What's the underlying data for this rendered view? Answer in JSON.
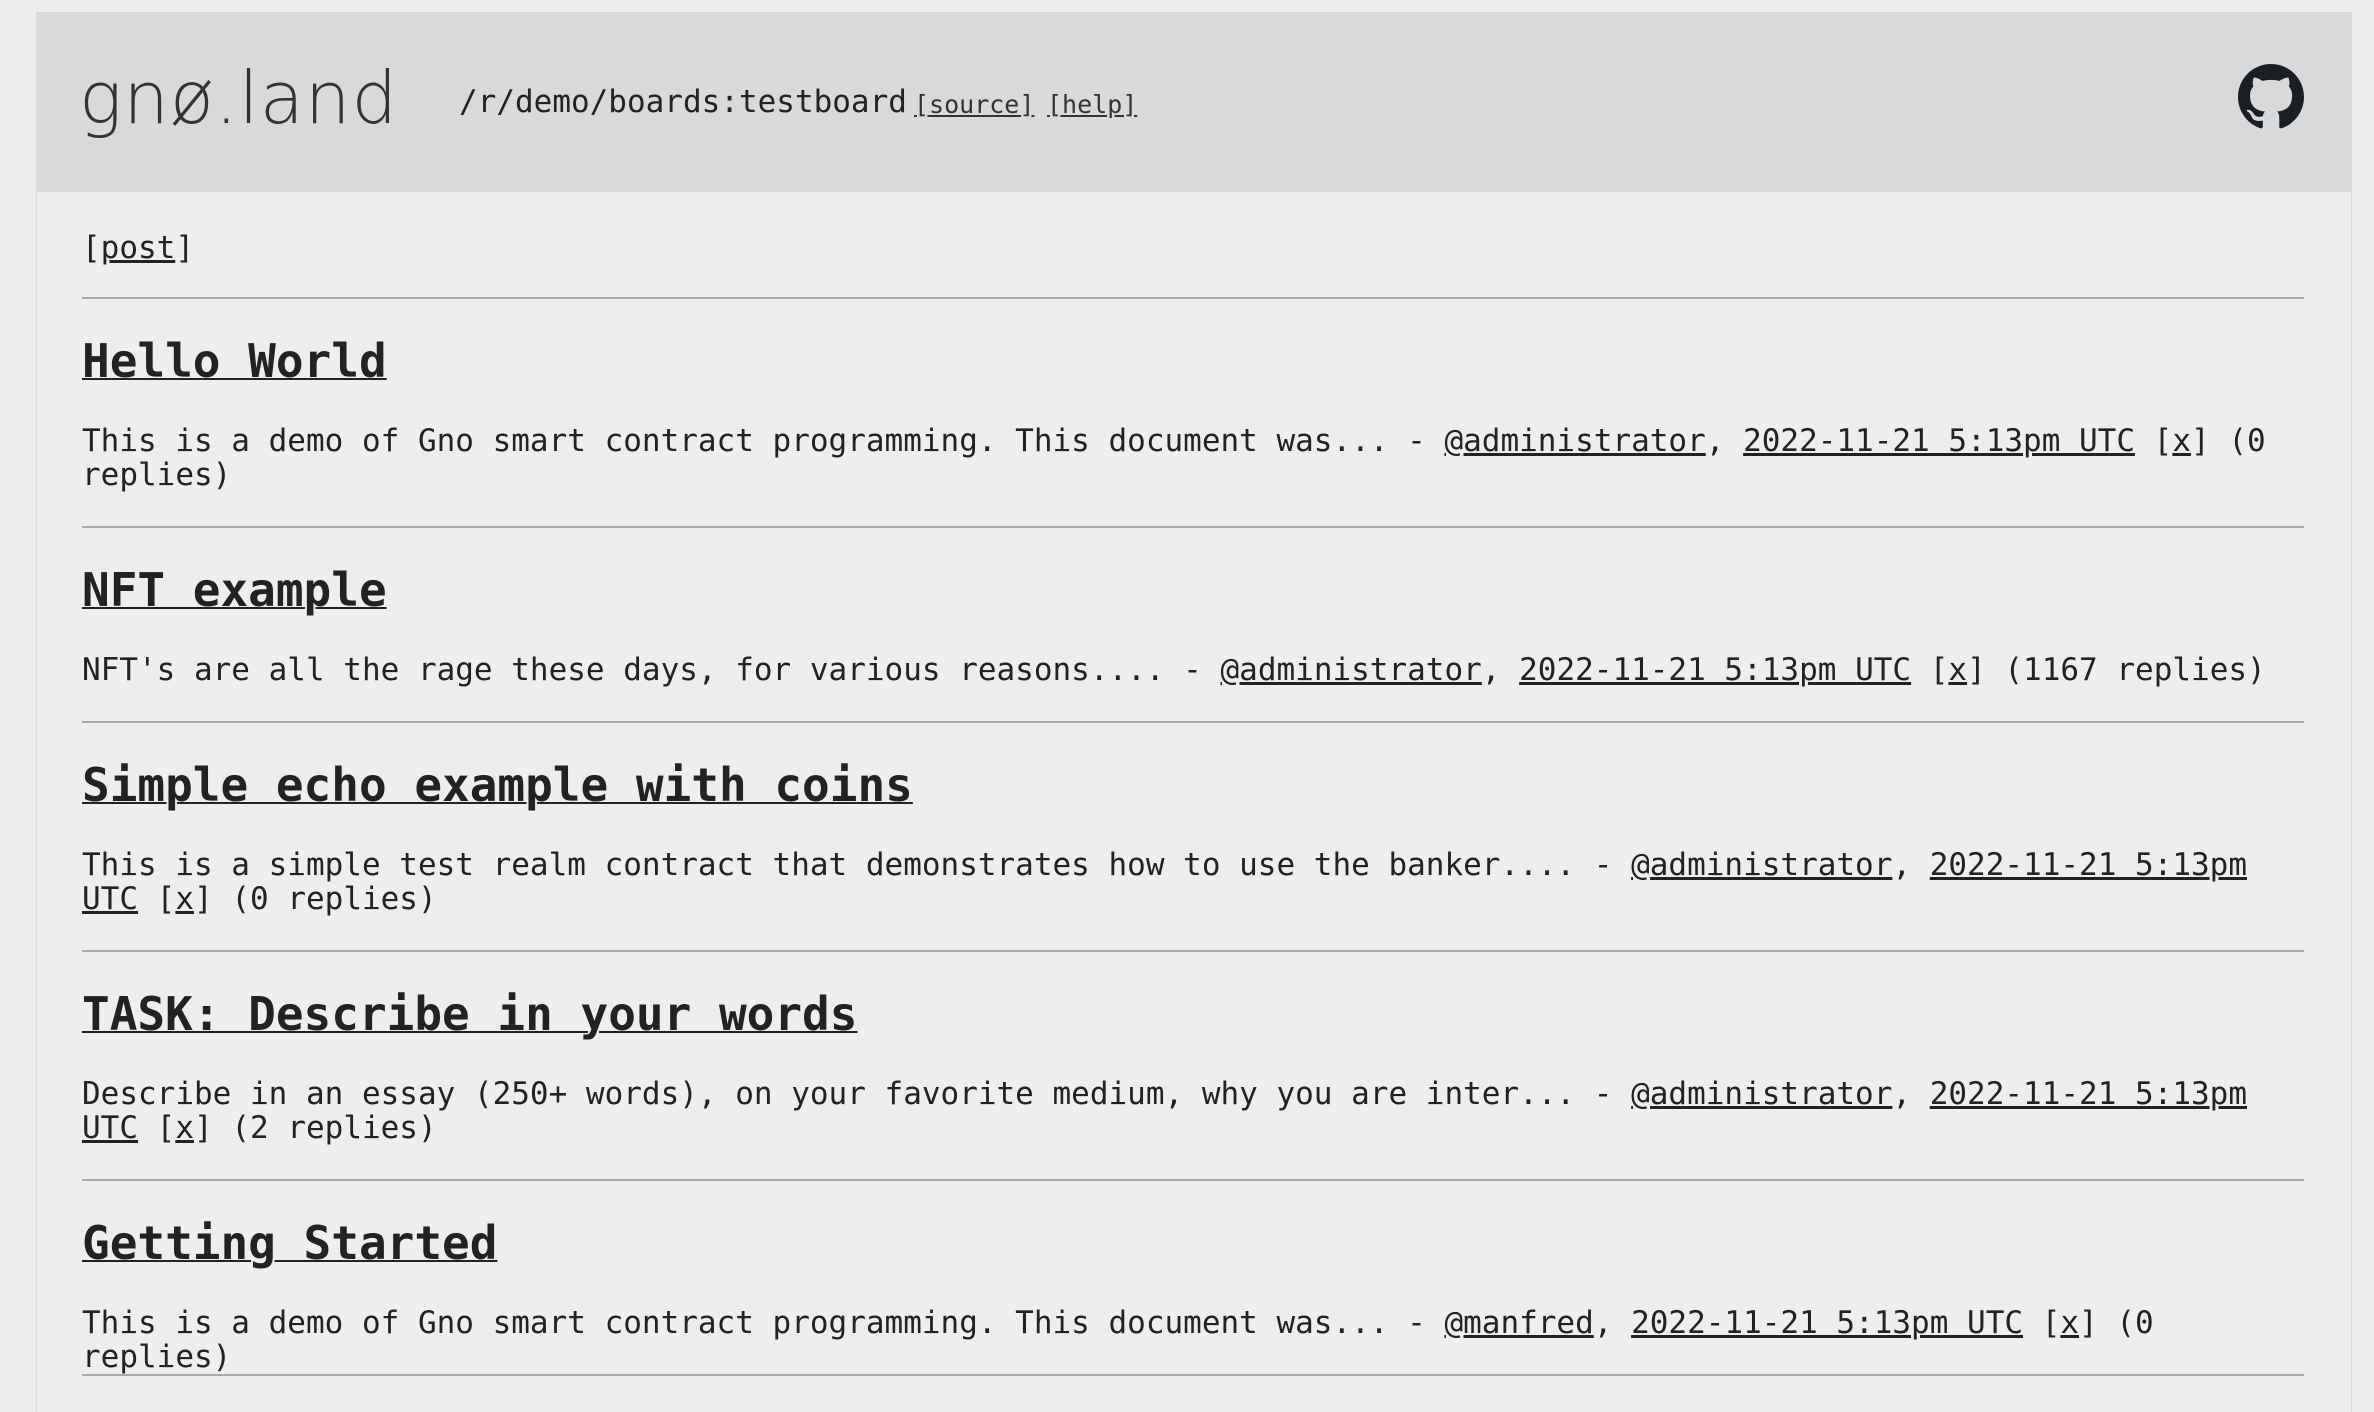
{
  "header": {
    "logo_text": "gnø.land",
    "path": "/r/demo/boards:testboard",
    "source_label": "[source]",
    "help_label": "[help]"
  },
  "actions": {
    "post_open": "[",
    "post_label": "post",
    "post_close": "]"
  },
  "threads": [
    {
      "title": "Hello World",
      "summary": "This is a demo of Gno smart contract programming. This document was...",
      "sep": " - ",
      "author": "@administrator",
      "comma": ", ",
      "date": "2022-11-21 5:13pm UTC",
      "x_open": " [",
      "x_label": "x",
      "x_close": "]",
      "replies": " (0 replies)"
    },
    {
      "title": "NFT example",
      "summary": "NFT's are all the rage these days, for various reasons....",
      "sep": " - ",
      "author": "@administrator",
      "comma": ", ",
      "date": "2022-11-21 5:13pm UTC",
      "x_open": " [",
      "x_label": "x",
      "x_close": "]",
      "replies": " (1167 replies)"
    },
    {
      "title": "Simple echo example with coins",
      "summary": "This is a simple test realm contract that demonstrates how to use the banker....",
      "sep": " - ",
      "author": "@administrator",
      "comma": ", ",
      "date": "2022-11-21 5:13pm UTC",
      "x_open": " [",
      "x_label": "x",
      "x_close": "]",
      "replies": " (0 replies)"
    },
    {
      "title": "TASK: Describe in your words",
      "summary": "Describe in an essay (250+ words), on your favorite medium, why you are inter...",
      "sep": " - ",
      "author": "@administrator",
      "comma": ", ",
      "date": "2022-11-21 5:13pm UTC",
      "x_open": " [",
      "x_label": "x",
      "x_close": "]",
      "replies": " (2 replies)"
    },
    {
      "title": "Getting Started",
      "summary": "This is a demo of Gno smart contract programming. This document was...",
      "sep": " - ",
      "author": "@manfred",
      "comma": ", ",
      "date": "2022-11-21 5:13pm UTC",
      "x_open": " [",
      "x_label": "x",
      "x_close": "]",
      "replies": " (0 replies)"
    }
  ],
  "colors": {
    "header_bg": "#d8d9db",
    "page_bg": "#eeeeee",
    "text": "#222222",
    "rule": "#aaaaaa"
  },
  "icons": {
    "github": "github-icon"
  }
}
